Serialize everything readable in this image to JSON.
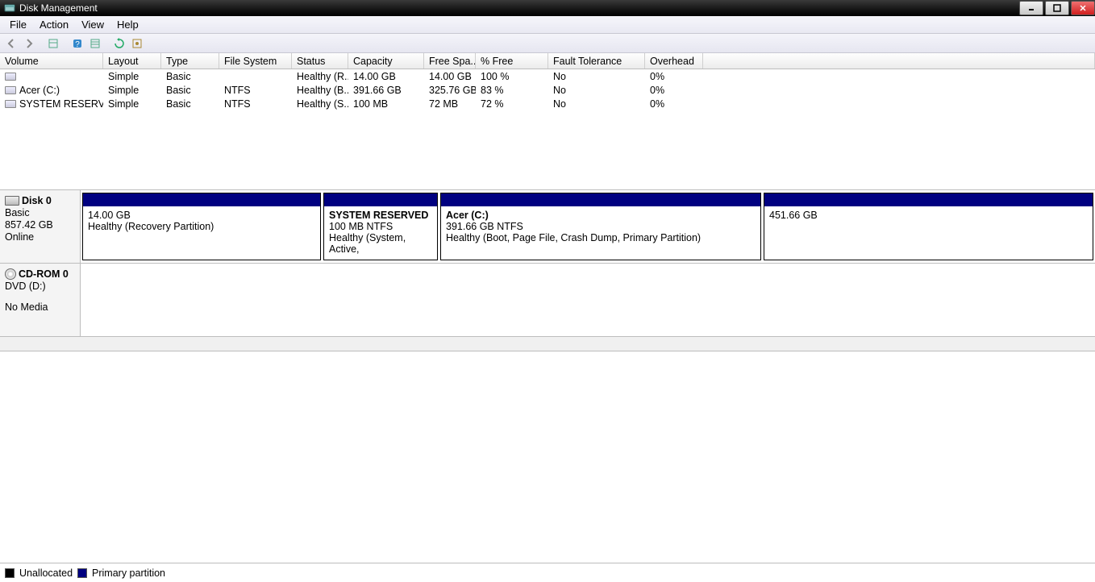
{
  "window": {
    "title": "Disk Management"
  },
  "menu": {
    "file": "File",
    "action": "Action",
    "view": "View",
    "help": "Help"
  },
  "columns": {
    "volume": "Volume",
    "layout": "Layout",
    "type": "Type",
    "fs": "File System",
    "status": "Status",
    "capacity": "Capacity",
    "free": "Free Spa...",
    "pfree": "% Free",
    "fault": "Fault Tolerance",
    "overhead": "Overhead"
  },
  "volumes": [
    {
      "name": "",
      "layout": "Simple",
      "type": "Basic",
      "fs": "",
      "status": "Healthy (R...",
      "capacity": "14.00 GB",
      "free": "14.00 GB",
      "pfree": "100 %",
      "fault": "No",
      "overhead": "0%"
    },
    {
      "name": "Acer (C:)",
      "layout": "Simple",
      "type": "Basic",
      "fs": "NTFS",
      "status": "Healthy (B...",
      "capacity": "391.66 GB",
      "free": "325.76 GB",
      "pfree": "83 %",
      "fault": "No",
      "overhead": "0%"
    },
    {
      "name": "SYSTEM RESERVED",
      "layout": "Simple",
      "type": "Basic",
      "fs": "NTFS",
      "status": "Healthy (S...",
      "capacity": "100 MB",
      "free": "72 MB",
      "pfree": "72 %",
      "fault": "No",
      "overhead": "0%"
    }
  ],
  "disk0": {
    "title": "Disk 0",
    "type": "Basic",
    "size": "857.42 GB",
    "status": "Online",
    "p0": {
      "size": "14.00 GB",
      "status": "Healthy (Recovery Partition)"
    },
    "p1": {
      "title": "SYSTEM RESERVED",
      "sizefs": "100 MB NTFS",
      "status": "Healthy (System, Active,"
    },
    "p2": {
      "title": "Acer  (C:)",
      "sizefs": "391.66 GB NTFS",
      "status": "Healthy (Boot, Page File, Crash Dump, Primary Partition)"
    },
    "p3": {
      "size": "451.66 GB"
    }
  },
  "cdrom": {
    "title": "CD-ROM 0",
    "type": "DVD (D:)",
    "status": "No Media"
  },
  "legend": {
    "unallocated": "Unallocated",
    "primary": "Primary partition"
  }
}
